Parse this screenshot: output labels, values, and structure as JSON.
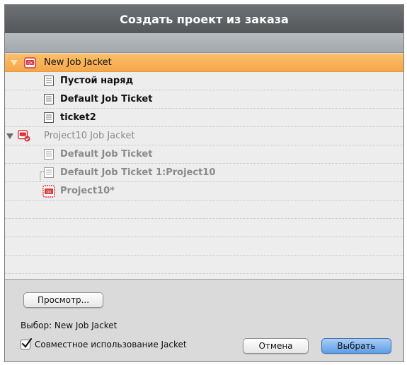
{
  "dialog": {
    "title": "Создать проект из заказа"
  },
  "tree": {
    "jacket1": {
      "label": "New Job Jacket",
      "tickets": [
        "Пустой наряд",
        "Default Job Ticket",
        "ticket2"
      ]
    },
    "jacket2": {
      "label": "Project10 Job Jacket",
      "tickets": [
        "Default Job Ticket",
        "Default Job Ticket 1:Project10"
      ],
      "project": "Project10*"
    }
  },
  "footer": {
    "preview_label": "Просмотр...",
    "selection_text": "Выбор: New Job Jacket",
    "share_label": "Совместное использование Jacket",
    "share_checked": true,
    "cancel_label": "Отмена",
    "choose_label": "Выбрать"
  },
  "colors": {
    "selection": "#f5a64a",
    "jacket_icon": "#d9363e",
    "default_button": "#5e9ee8"
  },
  "icons": {
    "jacket": "job-jacket-icon",
    "ticket": "job-ticket-icon",
    "project": "project-icon",
    "checkmark": "checkmark-icon"
  }
}
